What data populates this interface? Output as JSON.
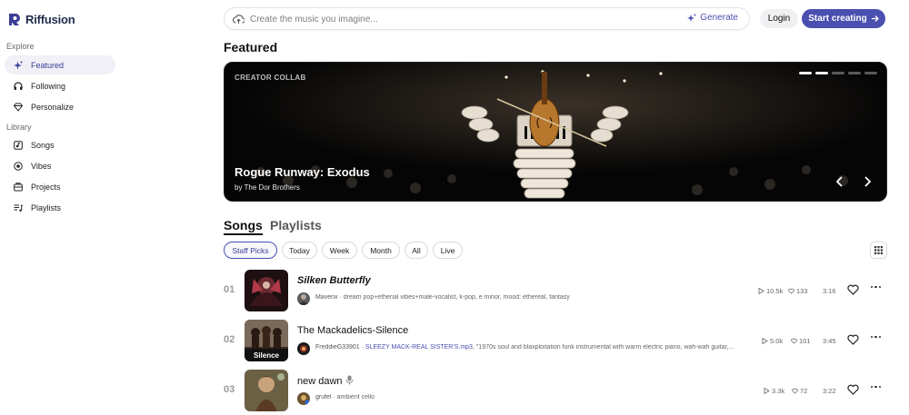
{
  "app": {
    "name": "Riffusion",
    "brand_color": "#4a4fb0"
  },
  "sidebar": {
    "sections": [
      {
        "label": "Explore",
        "items": [
          {
            "label": "Featured",
            "icon": "sparkle-icon",
            "active": true
          },
          {
            "label": "Following",
            "icon": "headphones-icon"
          },
          {
            "label": "Personalize",
            "icon": "diamond-icon"
          }
        ]
      },
      {
        "label": "Library",
        "items": [
          {
            "label": "Songs",
            "icon": "music-box-icon"
          },
          {
            "label": "Vibes",
            "icon": "vibes-icon"
          },
          {
            "label": "Projects",
            "icon": "folder-icon"
          },
          {
            "label": "Playlists",
            "icon": "playlist-icon"
          }
        ]
      }
    ]
  },
  "topbar": {
    "search_placeholder": "Create the music you imagine...",
    "generate_label": "Generate",
    "login_label": "Login",
    "start_label": "Start creating"
  },
  "featured": {
    "heading": "Featured",
    "tag": "CREATOR COLLAB",
    "title": "Rogue Runway: Exodus",
    "byline": "by The Dor Brothers",
    "slide_count": 5,
    "active_slide": 2
  },
  "songs_section": {
    "tabs": [
      {
        "label": "Songs",
        "active": true
      },
      {
        "label": "Playlists",
        "active": false
      }
    ],
    "filters": [
      {
        "label": "Staff Picks",
        "active": true
      },
      {
        "label": "Today"
      },
      {
        "label": "Week"
      },
      {
        "label": "Month"
      },
      {
        "label": "All"
      },
      {
        "label": "Live"
      }
    ]
  },
  "songs": [
    {
      "rank": "01",
      "title": "Silken Butterfly",
      "italic": true,
      "user": "Maverix",
      "link": "",
      "description": "dream pop+etherial vibes+male-vocalist, k-pop, e minor, mood: ethereal, fantasy",
      "plays": "10.5k",
      "likes": "133",
      "duration": "3:16"
    },
    {
      "rank": "02",
      "title": "The Mackadelics-Silence",
      "italic": false,
      "user": "FreddieG33901",
      "link": "SLEEZY MACK-REAL SISTER'S.mp3",
      "description": ", \"1970s soul and blaxploitation funk instrumental with warm electric piano, wah-wah guitar,...",
      "plays": "5.0k",
      "likes": "101",
      "duration": "3:45",
      "thumb_caption": "Silence"
    },
    {
      "rank": "03",
      "title": "new dawn",
      "italic": false,
      "user": "grufel",
      "link": "",
      "description": "ambient cello",
      "plays": "3.3k",
      "likes": "72",
      "duration": "3:22"
    }
  ]
}
